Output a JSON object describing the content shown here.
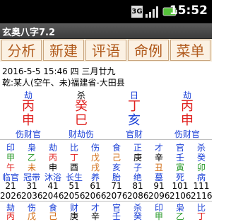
{
  "status": {
    "icon_3g": "3G",
    "time": "15:52"
  },
  "app_title": "玄奥八字7.2",
  "menu": [
    "分析",
    "新建",
    "评语",
    "命例",
    "菜单"
  ],
  "info": {
    "line1": "2016-5-5 15:46  四  三月廿九",
    "line2": "乾:某人(空午、未)福建省-大田县"
  },
  "pillars": [
    {
      "top": "劫",
      "stem": "丙",
      "branch": "申",
      "hidden": "伤财官"
    },
    {
      "top": "杀",
      "stem": "癸",
      "branch": "巳",
      "hidden": "财劫伤"
    },
    {
      "top": "日",
      "stem": "丁",
      "branch": "亥",
      "hidden": "官财"
    },
    {
      "top": "劫",
      "stem": "丙",
      "branch": "申",
      "hidden": "伤财官"
    }
  ],
  "dayun": {
    "gods": [
      "印",
      "枭",
      "劫",
      "比",
      "伤",
      "食",
      "正",
      "才",
      "官",
      "杀"
    ],
    "stems": [
      "甲",
      "乙",
      "丙",
      "丁",
      "戊",
      "己",
      "庚",
      "辛",
      "壬",
      "癸"
    ],
    "branches": [
      "午",
      "未",
      "申",
      "酉",
      "戌",
      "亥",
      "子",
      "丑",
      "寅",
      "卯"
    ],
    "states": [
      "临官",
      "冠带",
      "沐浴",
      "长生",
      "养",
      "胎",
      "绝",
      "墓",
      "死",
      "病"
    ],
    "ages": [
      "21",
      "31",
      "41",
      "51",
      "61",
      "71",
      "81",
      "91",
      "101",
      "111"
    ],
    "years": [
      "2026",
      "2036",
      "2046",
      "2056",
      "2066",
      "2076",
      "2086",
      "2096",
      "2106",
      "2116"
    ]
  },
  "row2": {
    "gods": [
      "劫",
      "伤",
      "食",
      "财",
      "才",
      "官",
      "杀",
      "印",
      "枭",
      "比"
    ],
    "stems": [
      "丙",
      "戊",
      "己",
      "庚",
      "辛",
      "壬",
      "癸",
      "甲",
      "乙",
      "丁"
    ]
  },
  "colors": {
    "fire": "#e0201e",
    "water": "#1a3fd6",
    "earth": "#d06a10",
    "wood": "#2a9a2a",
    "metal": "#000000"
  }
}
